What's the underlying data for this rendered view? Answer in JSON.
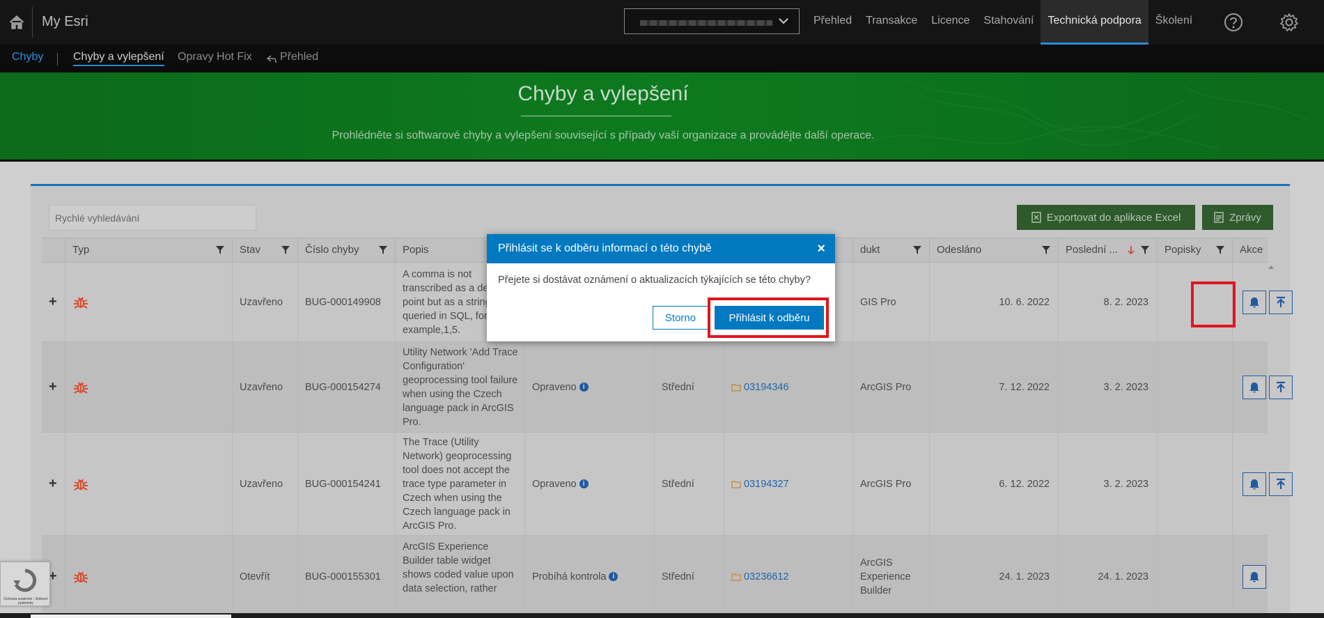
{
  "topbar": {
    "brand": "My Esri",
    "nav": [
      "Přehled",
      "Transakce",
      "Licence",
      "Stahování",
      "Technická podpora",
      "Školení"
    ],
    "active_nav": "Technická podpora"
  },
  "subnav": {
    "root": "Chyby",
    "active": "Chyby a vylepšení",
    "hotfix": "Opravy Hot Fix",
    "back": "Přehled"
  },
  "hero": {
    "title": "Chyby a vylepšení",
    "subtitle": "Prohlédněte si softwarové chyby a vylepšení související s případy vaší organizace a provádějte další operace."
  },
  "toolbar": {
    "search_placeholder": "Rychlé vyhledávání",
    "excel_label": "Exportovat do aplikace Excel",
    "reports_label": "Zprávy"
  },
  "table": {
    "headers": {
      "typ": "Typ",
      "stav": "Stav",
      "cislo": "Číslo chyby",
      "popis": "Popis",
      "produkt": "dukt",
      "odeslano": "Odesláno",
      "posledni": "Poslední ...",
      "popisky": "Popisky",
      "akce": "Akce"
    },
    "rows": [
      {
        "stav": "Uzavřeno",
        "cislo": "BUG-000149908",
        "popis": "A comma is not transcribed as a decimal point but as a string when queried in SQL, for example,1,5.",
        "reseni": "",
        "zavaznost": "",
        "pripad": "",
        "produkt": "GIS Pro",
        "odeslano": "10. 6. 2022",
        "posledni": "8. 2. 2023"
      },
      {
        "stav": "Uzavřeno",
        "cislo": "BUG-000154274",
        "popis": "Utility Network 'Add Trace Configuration' geoprocessing tool failure when using the Czech language pack in ArcGIS Pro.",
        "reseni": "Opraveno",
        "zavaznost": "Střední",
        "pripad": "03194346",
        "produkt": "ArcGIS Pro",
        "odeslano": "7. 12. 2022",
        "posledni": "3. 2. 2023"
      },
      {
        "stav": "Uzavřeno",
        "cislo": "BUG-000154241",
        "popis": "The Trace (Utility Network) geoprocessing tool does not accept the trace type parameter in Czech when using the Czech language pack in ArcGIS Pro.",
        "reseni": "Opraveno",
        "zavaznost": "Střední",
        "pripad": "03194327",
        "produkt": "ArcGIS Pro",
        "odeslano": "6. 12. 2022",
        "posledni": "3. 2. 2023"
      },
      {
        "stav": "Otevřít",
        "cislo": "BUG-000155301",
        "popis": "ArcGIS Experience Builder table widget shows coded value upon data selection, rather",
        "reseni": "Probíhá kontrola",
        "zavaznost": "Střední",
        "pripad": "03236612",
        "produkt": "ArcGIS Experience Builder",
        "odeslano": "24. 1. 2023",
        "posledni": "24. 1. 2023"
      }
    ]
  },
  "modal": {
    "title": "Přihlásit se k odběru informací o této chybě",
    "question": "Přejete si dostávat oznámení o aktualizacích týkajících se této chyby?",
    "cancel": "Storno",
    "subscribe": "Přihlásit k odběru"
  },
  "colors": {
    "accent": "#0079c1",
    "highlight": "#e0161e",
    "bug": "#d84a2a"
  }
}
